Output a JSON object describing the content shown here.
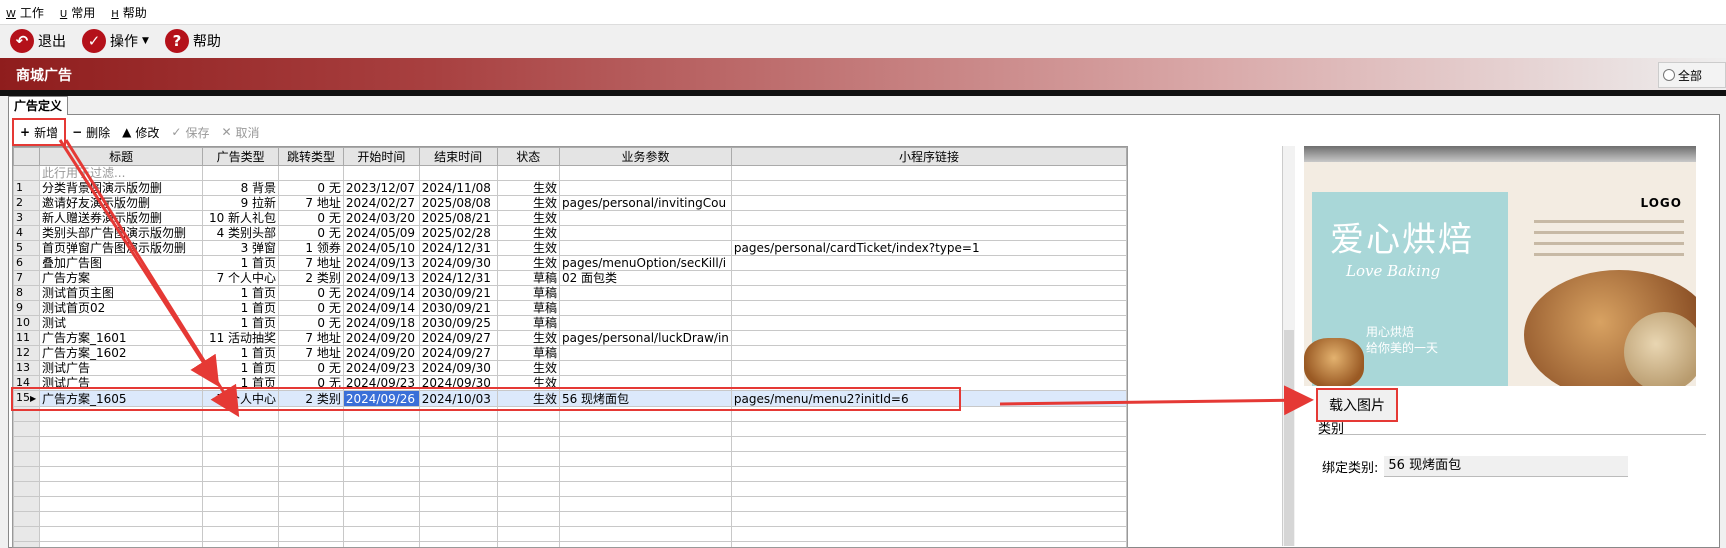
{
  "menubar": {
    "items": [
      {
        "key": "W",
        "label": "工作"
      },
      {
        "key": "U",
        "label": "常用"
      },
      {
        "key": "H",
        "label": "帮助"
      }
    ]
  },
  "toolbar": {
    "exit_label": "退出",
    "ops_label": "操作",
    "help_label": "帮助"
  },
  "banner": {
    "title": "商城广告",
    "radio_all_label": "全部"
  },
  "tab": {
    "label": "广告定义"
  },
  "grid_toolbar": {
    "add": "新增",
    "delete": "删除",
    "edit": "修改",
    "save": "保存",
    "cancel": "取消"
  },
  "grid": {
    "columns": [
      "标题",
      "广告类型",
      "跳转类型",
      "开始时间",
      "结束时间",
      "状态",
      "业务参数",
      "小程序链接"
    ],
    "filter_placeholder": "此行用于过滤...",
    "rows": [
      {
        "num": "1",
        "title": "分类背景图演示版勿删",
        "ad_type": "8 背景",
        "jump": "0 无",
        "start": "2023/12/07",
        "end": "2024/11/08",
        "status": "生效",
        "param": "",
        "link": ""
      },
      {
        "num": "2",
        "title": "邀请好友演示版勿删",
        "ad_type": "9 拉新",
        "jump": "7 地址",
        "start": "2024/02/27",
        "end": "2025/08/08",
        "status": "生效",
        "param": "pages/personal/invitingCou",
        "link": ""
      },
      {
        "num": "3",
        "title": "新人赠送券演示版勿删",
        "ad_type": "10 新人礼包",
        "jump": "0 无",
        "start": "2024/03/20",
        "end": "2025/08/21",
        "status": "生效",
        "param": "",
        "link": ""
      },
      {
        "num": "4",
        "title": "类别头部广告图演示版勿删",
        "ad_type": "4 类别头部",
        "jump": "0 无",
        "start": "2024/05/09",
        "end": "2025/02/28",
        "status": "生效",
        "param": "",
        "link": ""
      },
      {
        "num": "5",
        "title": "首页弹窗广告图演示版勿删",
        "ad_type": "3 弹窗",
        "jump": "1 领券",
        "start": "2024/05/10",
        "end": "2024/12/31",
        "status": "生效",
        "param": "",
        "link": "pages/personal/cardTicket/index?type=1"
      },
      {
        "num": "6",
        "title": "叠加广告图",
        "ad_type": "1 首页",
        "jump": "7 地址",
        "start": "2024/09/13",
        "end": "2024/09/30",
        "status": "生效",
        "param": "pages/menuOption/secKill/i",
        "link": ""
      },
      {
        "num": "7",
        "title": "广告方案",
        "ad_type": "7 个人中心",
        "jump": "2 类别",
        "start": "2024/09/13",
        "end": "2024/12/31",
        "status": "草稿",
        "param": "02 面包类",
        "link": ""
      },
      {
        "num": "8",
        "title": "测试首页主图",
        "ad_type": "1 首页",
        "jump": "0 无",
        "start": "2024/09/14",
        "end": "2030/09/21",
        "status": "草稿",
        "param": "",
        "link": ""
      },
      {
        "num": "9",
        "title": "测试首页02",
        "ad_type": "1 首页",
        "jump": "0 无",
        "start": "2024/09/14",
        "end": "2030/09/21",
        "status": "草稿",
        "param": "",
        "link": ""
      },
      {
        "num": "10",
        "title": "测试",
        "ad_type": "1 首页",
        "jump": "0 无",
        "start": "2024/09/18",
        "end": "2030/09/25",
        "status": "草稿",
        "param": "",
        "link": ""
      },
      {
        "num": "11",
        "title": "广告方案_1601",
        "ad_type": "11 活动抽奖",
        "jump": "7 地址",
        "start": "2024/09/20",
        "end": "2024/09/27",
        "status": "生效",
        "param": "pages/personal/luckDraw/in",
        "link": ""
      },
      {
        "num": "12",
        "title": "广告方案_1602",
        "ad_type": "1 首页",
        "jump": "7 地址",
        "start": "2024/09/20",
        "end": "2024/09/27",
        "status": "草稿",
        "param": "",
        "link": ""
      },
      {
        "num": "13",
        "title": "测试广告",
        "ad_type": "1 首页",
        "jump": "0 无",
        "start": "2024/09/23",
        "end": "2024/09/30",
        "status": "生效",
        "param": "",
        "link": ""
      },
      {
        "num": "14",
        "title": "测试广告",
        "ad_type": "1 首页",
        "jump": "0 无",
        "start": "2024/09/23",
        "end": "2024/09/30",
        "status": "生效",
        "param": "",
        "link": ""
      },
      {
        "num": "15",
        "title": "广告方案_1605",
        "ad_type": "7 个人中心",
        "jump": "2 类别",
        "start": "2024/09/26",
        "end": "2024/10/03",
        "status": "生效",
        "param": "56 现烤面包",
        "link": "pages/menu/menu2?initId=6",
        "selected": true
      }
    ],
    "empty_rows": 10
  },
  "preview": {
    "title_cn": "爱心烘焙",
    "title_en": "Love Baking",
    "slogan_1": "用心烘焙",
    "slogan_2": "给你美的一天",
    "logo": "LOGO"
  },
  "side_panel": {
    "load_image_label": "载入图片",
    "category_header": "类别",
    "bind_label": "绑定类别:",
    "bind_value": "56 现烤面包"
  },
  "colors": {
    "banner_dark": "#8f1d1d",
    "icon_red": "#b4111a",
    "annotation_red": "#e53935",
    "selection_blue": "#3a6fd8"
  }
}
